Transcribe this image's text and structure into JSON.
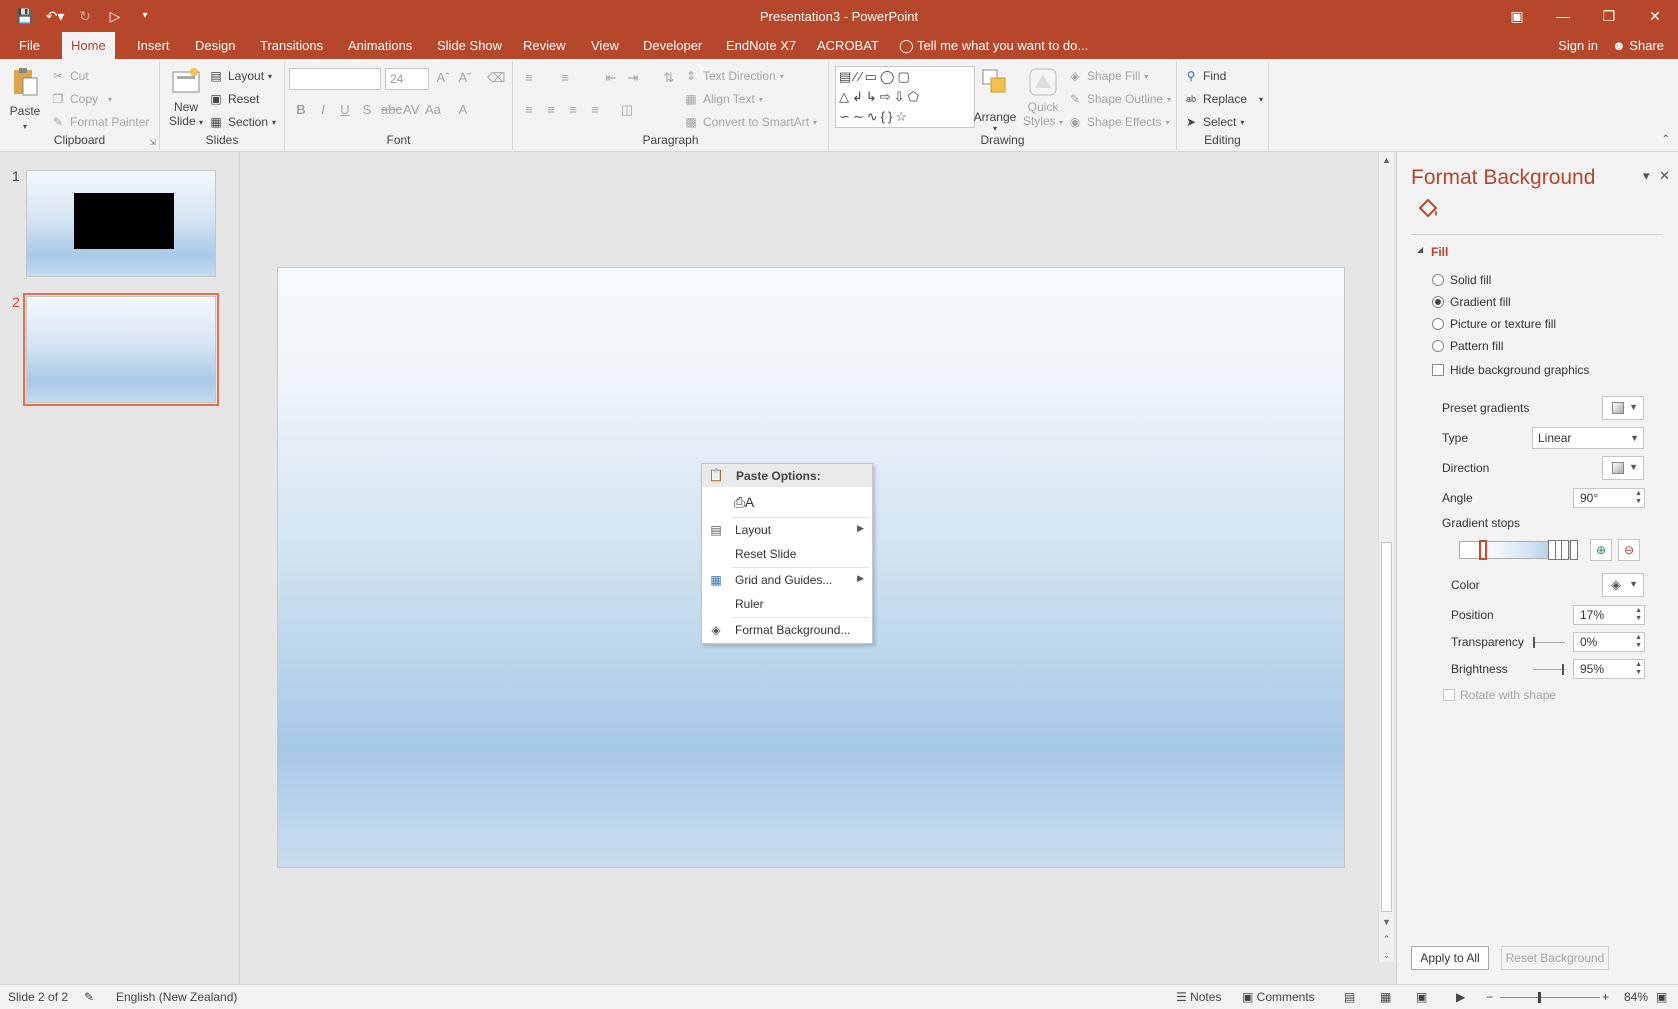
{
  "window": {
    "title": "Presentation3 - PowerPoint",
    "qat": {
      "save_icon": "save-icon",
      "undo_icon": "undo-icon",
      "redo_icon": "redo-icon",
      "start_icon": "start-from-beginning-icon",
      "customize_icon": "customize-qat-icon"
    }
  },
  "tabs": [
    "File",
    "Home",
    "Insert",
    "Design",
    "Transitions",
    "Animations",
    "Slide Show",
    "Review",
    "View",
    "Developer",
    "EndNote X7",
    "ACROBAT"
  ],
  "active_tab": "Home",
  "tell_me": "Tell me what you want to do...",
  "sign_in": "Sign in",
  "share": "Share",
  "ribbon": {
    "clipboard": {
      "name": "Clipboard",
      "paste": "Paste",
      "cut": "Cut",
      "copy": "Copy",
      "format_painter": "Format Painter"
    },
    "slides": {
      "name": "Slides",
      "new_slide_line1": "New",
      "new_slide_line2": "Slide",
      "layout": "Layout",
      "reset": "Reset",
      "section": "Section"
    },
    "font": {
      "name": "Font",
      "font_name": "",
      "font_size": "24"
    },
    "paragraph": {
      "name": "Paragraph",
      "text_direction": "Text Direction",
      "align_text": "Align Text",
      "convert_smartart": "Convert to SmartArt"
    },
    "drawing": {
      "name": "Drawing",
      "arrange": "Arrange",
      "quick_styles_line1": "Quick",
      "quick_styles_line2": "Styles",
      "shape_fill": "Shape Fill",
      "shape_outline": "Shape Outline",
      "shape_effects": "Shape Effects"
    },
    "editing": {
      "name": "Editing",
      "find": "Find",
      "replace": "Replace",
      "select": "Select"
    }
  },
  "thumbnails": [
    {
      "number": "1",
      "has_black_box": true,
      "selected": false
    },
    {
      "number": "2",
      "has_black_box": false,
      "selected": true
    }
  ],
  "context_menu": {
    "paste_options": "Paste Options:",
    "items": [
      "Layout",
      "Reset Slide",
      "Grid and Guides...",
      "Ruler",
      "Format Background..."
    ]
  },
  "format_background": {
    "title": "Format Background",
    "section": "Fill",
    "fill_options": [
      "Solid fill",
      "Gradient fill",
      "Picture or texture fill",
      "Pattern fill"
    ],
    "selected_fill": "Gradient fill",
    "hide_background_graphics": "Hide background graphics",
    "preset_gradients": "Preset gradients",
    "type_label": "Type",
    "type_value": "Linear",
    "direction_label": "Direction",
    "angle_label": "Angle",
    "angle_value": "90°",
    "gradient_stops": "Gradient stops",
    "color_label": "Color",
    "position_label": "Position",
    "position_value": "17%",
    "transparency_label": "Transparency",
    "transparency_value": "0%",
    "brightness_label": "Brightness",
    "brightness_value": "95%",
    "rotate_with_shape": "Rotate with shape",
    "apply_to_all": "Apply to All",
    "reset_background": "Reset Background",
    "gradient_stop_positions": [
      0.17,
      0.8,
      0.86,
      0.92,
      1.0
    ],
    "transparency_fraction": 0.0,
    "brightness_fraction": 0.95
  },
  "status": {
    "slide_info": "Slide 2 of 2",
    "language": "English (New Zealand)",
    "notes": "Notes",
    "comments": "Comments",
    "zoom": "84%"
  },
  "colors": {
    "accent": "#b7472a",
    "selection": "#e4704f"
  }
}
